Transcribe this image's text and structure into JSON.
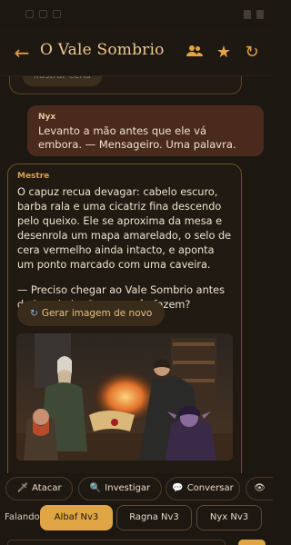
{
  "app": {
    "title": "O Vale Sombrio",
    "icons": [
      "back-arrow-icon",
      "group-icon",
      "star-icon",
      "refresh-icon"
    ],
    "accent": "#e0a545"
  },
  "chat": {
    "previous_button_label": "Ilustrar cena",
    "user_message": {
      "author": "Nyx",
      "text": "Levanto a mão antes que ele vá embora. — Mensageiro. Uma palavra."
    },
    "gm_message": {
      "author": "Mestre",
      "paragraph1": "O capuz recua devagar: cabelo escuro, barba rala e uma cicatriz fina descendo pelo queixo. Ele se aproxima da mesa e desenrola um mapa amarelado, o selo de cera vermelho ainda intacto, e aponta um ponto marcado com uma caveira.",
      "paragraph2": "— Preciso chegar ao Vale Sombrio antes da lua cheia. O que vocês fazem?",
      "regen_label": "Gerar imagem de novo",
      "regen_icon": "refresh-icon"
    }
  },
  "actions": [
    {
      "label": "Atacar",
      "icon": "dagger-icon"
    },
    {
      "label": "Investigar",
      "icon": "magnifier-icon"
    },
    {
      "label": "Conversar",
      "icon": "speech-bubble-icon"
    },
    {
      "label": "",
      "icon": "eye-icon"
    }
  ],
  "speaker": {
    "label": "Falando:",
    "characters": [
      {
        "name": "Albaf  Nv3",
        "selected": true
      },
      {
        "name": "Ragna  Nv3",
        "selected": false
      },
      {
        "name": "Nyx  Nv3",
        "selected": false
      }
    ]
  }
}
